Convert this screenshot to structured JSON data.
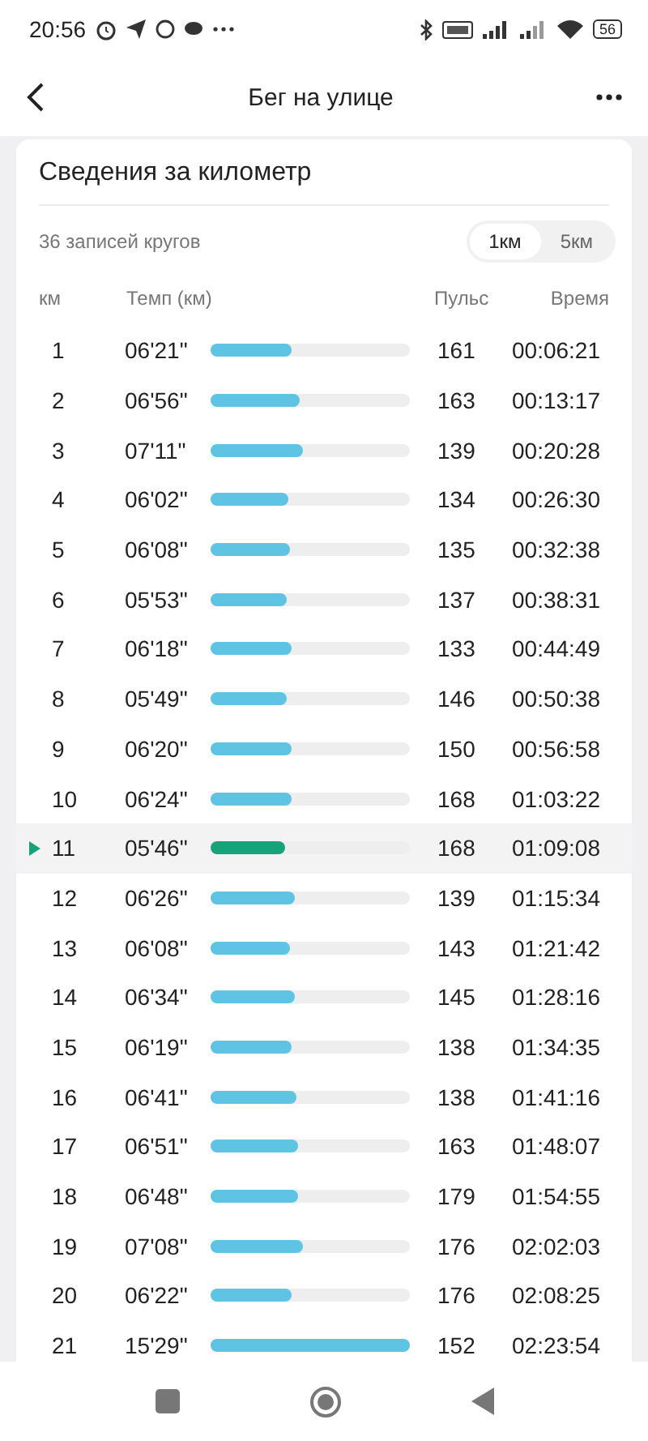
{
  "status_bar": {
    "time": "20:56",
    "battery": "56"
  },
  "header": {
    "title": "Бег на улице"
  },
  "card": {
    "title": "Сведения за километр",
    "records": "36 записей кругов",
    "toggle": [
      {
        "label": "1км",
        "selected": true
      },
      {
        "label": "5км",
        "selected": false
      }
    ],
    "columns": [
      "км",
      "Темп (км)",
      "Пульс",
      "Время"
    ],
    "rows": [
      {
        "km": "1",
        "pace": "06'21\"",
        "level": 0.41,
        "pulse": "161",
        "time": "00:06:21",
        "selected": false
      },
      {
        "km": "2",
        "pace": "06'56\"",
        "level": 0.45,
        "pulse": "163",
        "time": "00:13:17",
        "selected": false
      },
      {
        "km": "3",
        "pace": "07'11\"",
        "level": 0.46,
        "pulse": "139",
        "time": "00:20:28",
        "selected": false
      },
      {
        "km": "4",
        "pace": "06'02\"",
        "level": 0.39,
        "pulse": "134",
        "time": "00:26:30",
        "selected": false
      },
      {
        "km": "5",
        "pace": "06'08\"",
        "level": 0.4,
        "pulse": "135",
        "time": "00:32:38",
        "selected": false
      },
      {
        "km": "6",
        "pace": "05'53\"",
        "level": 0.38,
        "pulse": "137",
        "time": "00:38:31",
        "selected": false
      },
      {
        "km": "7",
        "pace": "06'18\"",
        "level": 0.41,
        "pulse": "133",
        "time": "00:44:49",
        "selected": false
      },
      {
        "km": "8",
        "pace": "05'49\"",
        "level": 0.38,
        "pulse": "146",
        "time": "00:50:38",
        "selected": false
      },
      {
        "km": "9",
        "pace": "06'20\"",
        "level": 0.41,
        "pulse": "150",
        "time": "00:56:58",
        "selected": false
      },
      {
        "km": "10",
        "pace": "06'24\"",
        "level": 0.41,
        "pulse": "168",
        "time": "01:03:22",
        "selected": false
      },
      {
        "km": "11",
        "pace": "05'46\"",
        "level": 0.37,
        "pulse": "168",
        "time": "01:09:08",
        "selected": true
      },
      {
        "km": "12",
        "pace": "06'26\"",
        "level": 0.42,
        "pulse": "139",
        "time": "01:15:34",
        "selected": false
      },
      {
        "km": "13",
        "pace": "06'08\"",
        "level": 0.4,
        "pulse": "143",
        "time": "01:21:42",
        "selected": false
      },
      {
        "km": "14",
        "pace": "06'34\"",
        "level": 0.42,
        "pulse": "145",
        "time": "01:28:16",
        "selected": false
      },
      {
        "km": "15",
        "pace": "06'19\"",
        "level": 0.41,
        "pulse": "138",
        "time": "01:34:35",
        "selected": false
      },
      {
        "km": "16",
        "pace": "06'41\"",
        "level": 0.43,
        "pulse": "138",
        "time": "01:41:16",
        "selected": false
      },
      {
        "km": "17",
        "pace": "06'51\"",
        "level": 0.44,
        "pulse": "163",
        "time": "01:48:07",
        "selected": false
      },
      {
        "km": "18",
        "pace": "06'48\"",
        "level": 0.44,
        "pulse": "179",
        "time": "01:54:55",
        "selected": false
      },
      {
        "km": "19",
        "pace": "07'08\"",
        "level": 0.46,
        "pulse": "176",
        "time": "02:02:03",
        "selected": false
      },
      {
        "km": "20",
        "pace": "06'22\"",
        "level": 0.41,
        "pulse": "176",
        "time": "02:08:25",
        "selected": false
      },
      {
        "km": "21",
        "pace": "15'29\"",
        "level": 1.0,
        "pulse": "152",
        "time": "02:23:54",
        "selected": false
      }
    ]
  }
}
